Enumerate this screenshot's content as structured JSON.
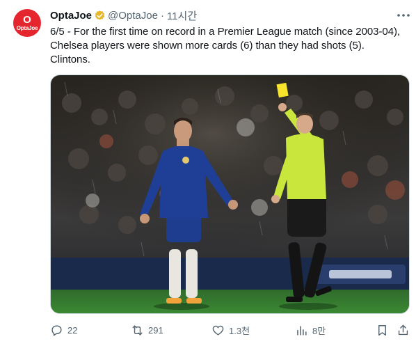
{
  "author": {
    "name": "OptaJoe",
    "handle": "@OptaJoe",
    "separator": "·",
    "time": "11시간",
    "avatar_top": "O",
    "avatar_bottom": "OptaJoe",
    "verified_color": "#e8b829"
  },
  "tweet": {
    "text": "6/5 - For the first time on record in a Premier League match (since 2003-04), Chelsea players were shown more cards (6) than they had shots (5). Clintons."
  },
  "media": {
    "alt": "Chelsea player being shown a yellow card by the referee on a rainy night"
  },
  "actions": {
    "replies": "22",
    "retweets": "291",
    "likes": "1.3천",
    "views": "8만"
  },
  "icons": {
    "more": "more-icon",
    "reply": "reply-icon",
    "retweet": "retweet-icon",
    "like": "like-icon",
    "views": "views-icon",
    "bookmark": "bookmark-icon",
    "share": "share-icon"
  },
  "colors": {
    "text": "#0f1419",
    "secondary": "#536471",
    "brand": "#e5262e"
  }
}
